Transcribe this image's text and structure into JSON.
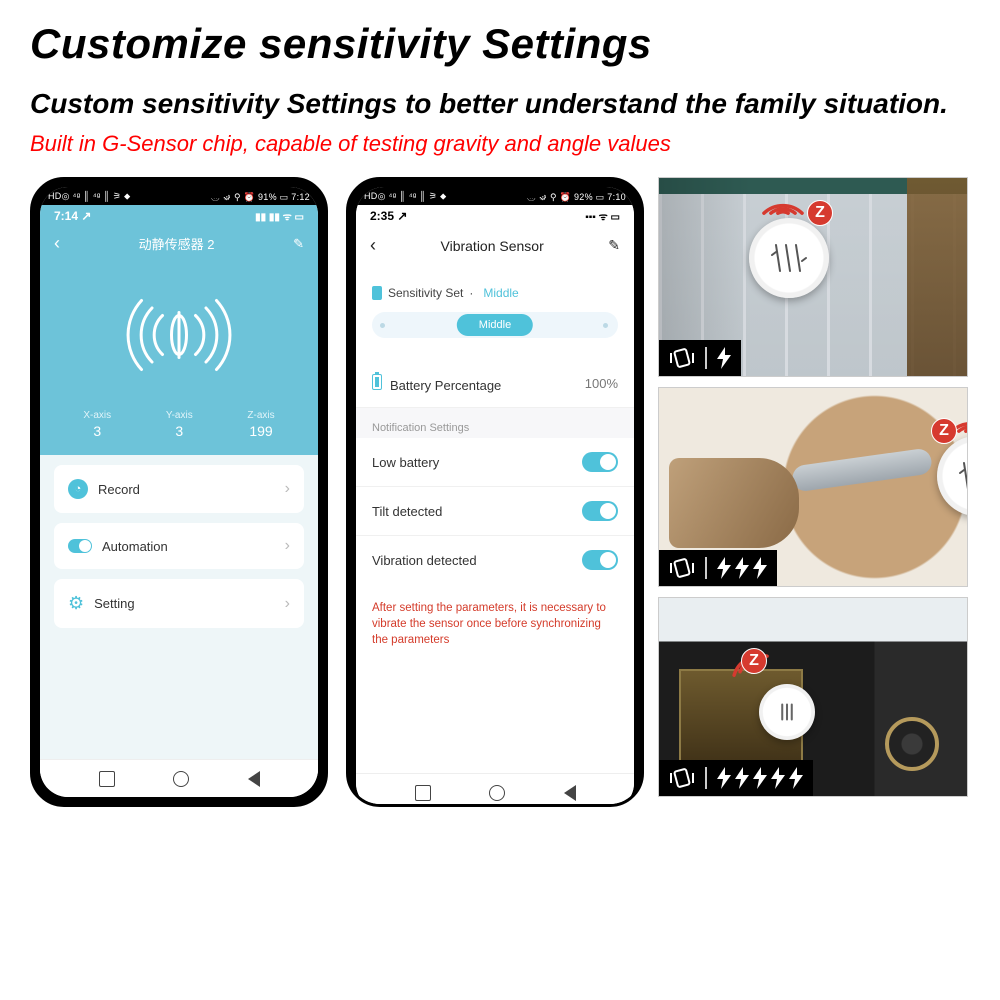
{
  "header": {
    "title": "Customize sensitivity Settings",
    "subtitle": "Custom sensitivity Settings to better understand the family situation.",
    "redline": "Built in G-Sensor chip, capable of testing gravity and angle values"
  },
  "phone1": {
    "android_bar_left": "HD◎ ⁴ᵍ ║ ⁴ᵍ ║ ⚞ ⬥",
    "android_bar_right": "ⓝ ⚙ ⚲ ⏰ 91% ▭ 7:12",
    "ios_time": "7:14 ↗",
    "title": "动静传感器 2",
    "axes": {
      "x_label": "X-axis",
      "x_val": "3",
      "y_label": "Y-axis",
      "y_val": "3",
      "z_label": "Z-axis",
      "z_val": "199"
    },
    "rows": {
      "record": "Record",
      "automation": "Automation",
      "setting": "Setting"
    }
  },
  "phone2": {
    "android_bar_left": "HD◎ ⁴ᵍ ║ ⁴ᵍ ║ ⚞ ⬥",
    "android_bar_right": "ⓝ ⚙ ⚲ ⏰ 92% ▭ 7:10",
    "ios_time": "2:35 ↗",
    "title": "Vibration Sensor",
    "sensitivity_label": "Sensitivity Set",
    "sensitivity_value": "Middle",
    "slider_value": "Middle",
    "battery_label": "Battery Percentage",
    "battery_value": "100%",
    "group_label": "Notification Settings",
    "toggles": {
      "low_battery": "Low battery",
      "tilt": "Tilt detected",
      "vibration": "Vibration detected"
    },
    "warning": "After setting the parameters, it is necessary to vibrate the sensor once before synchronizing the parameters"
  },
  "right": {
    "bolts": {
      "tile1": 1,
      "tile2": 3,
      "tile3": 5
    },
    "zigbee_label": "Z"
  }
}
